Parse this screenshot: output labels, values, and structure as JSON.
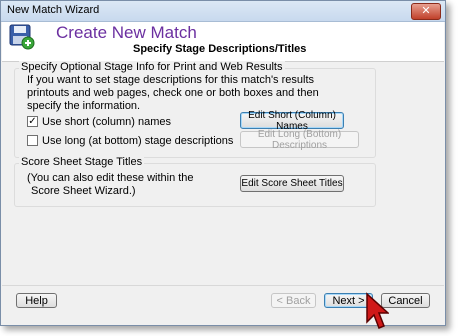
{
  "window": {
    "title": "New Match Wizard",
    "close_glyph": "✕"
  },
  "header": {
    "icon": "save-icon",
    "title": "Create New Match",
    "subtitle": "Specify Stage Descriptions/Titles"
  },
  "stage_info": {
    "group_title": "Specify Optional Stage Info for Print and Web Results",
    "description_line1": "If you want to set stage descriptions for this match's results",
    "description_line2": "printouts and web pages, check one or both boxes and then",
    "description_line3": "specify the information.",
    "short_names": {
      "label": "Use short (column) names",
      "checked": true,
      "check_glyph": "✓"
    },
    "long_desc": {
      "label": "Use long (at bottom) stage descriptions",
      "checked": false
    },
    "edit_short_button": "Edit Short (Column) Names",
    "edit_long_button": "Edit Long (Bottom) Descriptions"
  },
  "score_sheet": {
    "group_title": "Score Sheet Stage Titles",
    "note_line1": "(You can also edit these within the",
    "note_line2": "Score Sheet Wizard.)",
    "edit_button": "Edit Score Sheet Titles"
  },
  "footer": {
    "help": "Help",
    "back": "< Back",
    "next": "Next >",
    "cancel": "Cancel"
  },
  "colors": {
    "title_purple": "#6b2fa0",
    "cursor_red": "#d01818"
  }
}
